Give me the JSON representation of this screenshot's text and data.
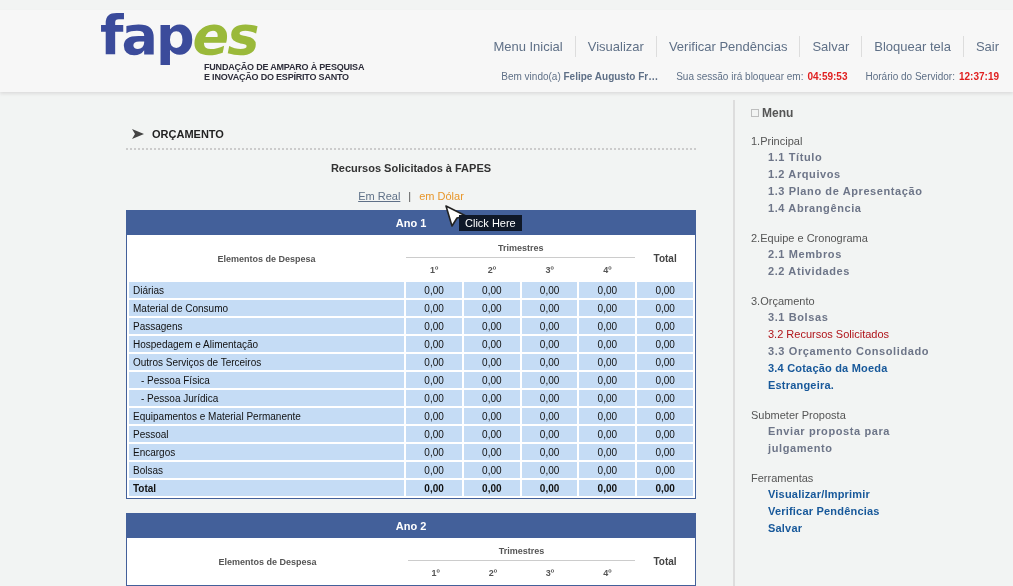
{
  "logo": {
    "part_1": "fap",
    "part_2": "es",
    "tagline": [
      "FUNDAÇÃO DE AMPARO À PESQUISA",
      "E INOVAÇÃO DO ESPÍRITO SANTO"
    ]
  },
  "top_nav": [
    "Menu Inicial",
    "Visualizar",
    "Verificar Pendências",
    "Salvar",
    "Bloquear tela",
    "Sair"
  ],
  "status": {
    "welcome_label": "Bem vindo(a)",
    "user": "Felipe Augusto Fr…",
    "session_label": "Sua sessão irá bloquear em:",
    "session_time": "04:59:53",
    "server_label": "Horário do Servidor:",
    "server_time": "12:37:19"
  },
  "section_title": "ORÇAMENTO",
  "page_title": "Recursos Solicitados à FAPES",
  "currency_links": [
    {
      "label": "Em Real",
      "selected": false
    },
    {
      "label": "em Dólar",
      "selected": true
    }
  ],
  "separator": "|",
  "tooltip": "Click Here",
  "tables": [
    {
      "title": "Ano 1",
      "label_header": "Elementos de Despesa",
      "group_header": "Trimestres",
      "quarters": [
        "1º",
        "2º",
        "3º",
        "4º"
      ],
      "total_header": "Total",
      "rows": [
        {
          "label": "Diárias",
          "kind": "plain",
          "values": [
            "0,00",
            "0,00",
            "0,00",
            "0,00",
            "0,00"
          ]
        },
        {
          "label": "Material de Consumo",
          "kind": "plain",
          "values": [
            "0,00",
            "0,00",
            "0,00",
            "0,00",
            "0,00"
          ]
        },
        {
          "label": "Passagens",
          "kind": "plain",
          "values": [
            "0,00",
            "0,00",
            "0,00",
            "0,00",
            "0,00"
          ]
        },
        {
          "label": "Hospedagem e Alimentação",
          "kind": "plain",
          "values": [
            "0,00",
            "0,00",
            "0,00",
            "0,00",
            "0,00"
          ]
        },
        {
          "label": "Outros Serviços de Terceiros",
          "kind": "plain",
          "values": [
            "0,00",
            "0,00",
            "0,00",
            "0,00",
            "0,00"
          ]
        },
        {
          "label": "- Pessoa Física",
          "kind": "sub",
          "values": [
            "0,00",
            "0,00",
            "0,00",
            "0,00",
            "0,00"
          ]
        },
        {
          "label": "- Pessoa Jurídica",
          "kind": "sub",
          "values": [
            "0,00",
            "0,00",
            "0,00",
            "0,00",
            "0,00"
          ]
        },
        {
          "label": "Equipamentos e Material Permanente",
          "kind": "plain",
          "values": [
            "0,00",
            "0,00",
            "0,00",
            "0,00",
            "0,00"
          ]
        },
        {
          "label": "Pessoal",
          "kind": "plain",
          "values": [
            "0,00",
            "0,00",
            "0,00",
            "0,00",
            "0,00"
          ]
        },
        {
          "label": "Encargos",
          "kind": "plain",
          "values": [
            "0,00",
            "0,00",
            "0,00",
            "0,00",
            "0,00"
          ]
        },
        {
          "label": "Bolsas",
          "kind": "plain",
          "values": [
            "0,00",
            "0,00",
            "0,00",
            "0,00",
            "0,00"
          ]
        },
        {
          "label": "Total",
          "kind": "total",
          "values": [
            "0,00",
            "0,00",
            "0,00",
            "0,00",
            "0,00"
          ]
        }
      ]
    },
    {
      "title": "Ano 2",
      "label_header": "Elementos de Despesa",
      "group_header": "Trimestres",
      "quarters": [
        "1º",
        "2º",
        "3º",
        "4º"
      ],
      "total_header": "Total"
    }
  ],
  "sidebar": {
    "title": "Menu",
    "sections": [
      {
        "heading": "1.Principal",
        "items": [
          {
            "label": "1.1 Título",
            "kind": "nav",
            "selected": false
          },
          {
            "label": "1.2 Arquivos",
            "kind": "nav",
            "selected": false
          },
          {
            "label": "1.3 Plano de Apresentação",
            "kind": "nav",
            "selected": false
          },
          {
            "label": "1.4 Abrangência",
            "kind": "nav",
            "selected": false
          }
        ]
      },
      {
        "heading": "2.Equipe e Cronograma",
        "items": [
          {
            "label": "2.1 Membros",
            "kind": "nav",
            "selected": false
          },
          {
            "label": "2.2 Atividades",
            "kind": "nav",
            "selected": false
          }
        ]
      },
      {
        "heading": "3.Orçamento",
        "items": [
          {
            "label": "3.1 Bolsas",
            "kind": "nav",
            "selected": false
          },
          {
            "label": "3.2 Recursos Solicitados",
            "kind": "nav",
            "selected": true
          },
          {
            "label": "3.3 Orçamento Consolidado",
            "kind": "nav",
            "selected": false
          },
          {
            "label": "3.4 Cotação da Moeda Estrangeira.",
            "kind": "link",
            "selected": false
          }
        ]
      },
      {
        "heading": "Submeter Proposta",
        "items": [
          {
            "label": "Enviar proposta para julgamento",
            "kind": "nav",
            "selected": false
          }
        ]
      },
      {
        "heading": "Ferramentas",
        "items": [
          {
            "label": "Visualizar/Imprimir",
            "kind": "link",
            "selected": false
          },
          {
            "label": "Verificar Pendências",
            "kind": "link",
            "selected": false
          },
          {
            "label": "Salvar",
            "kind": "link",
            "selected": false
          }
        ]
      }
    ]
  }
}
